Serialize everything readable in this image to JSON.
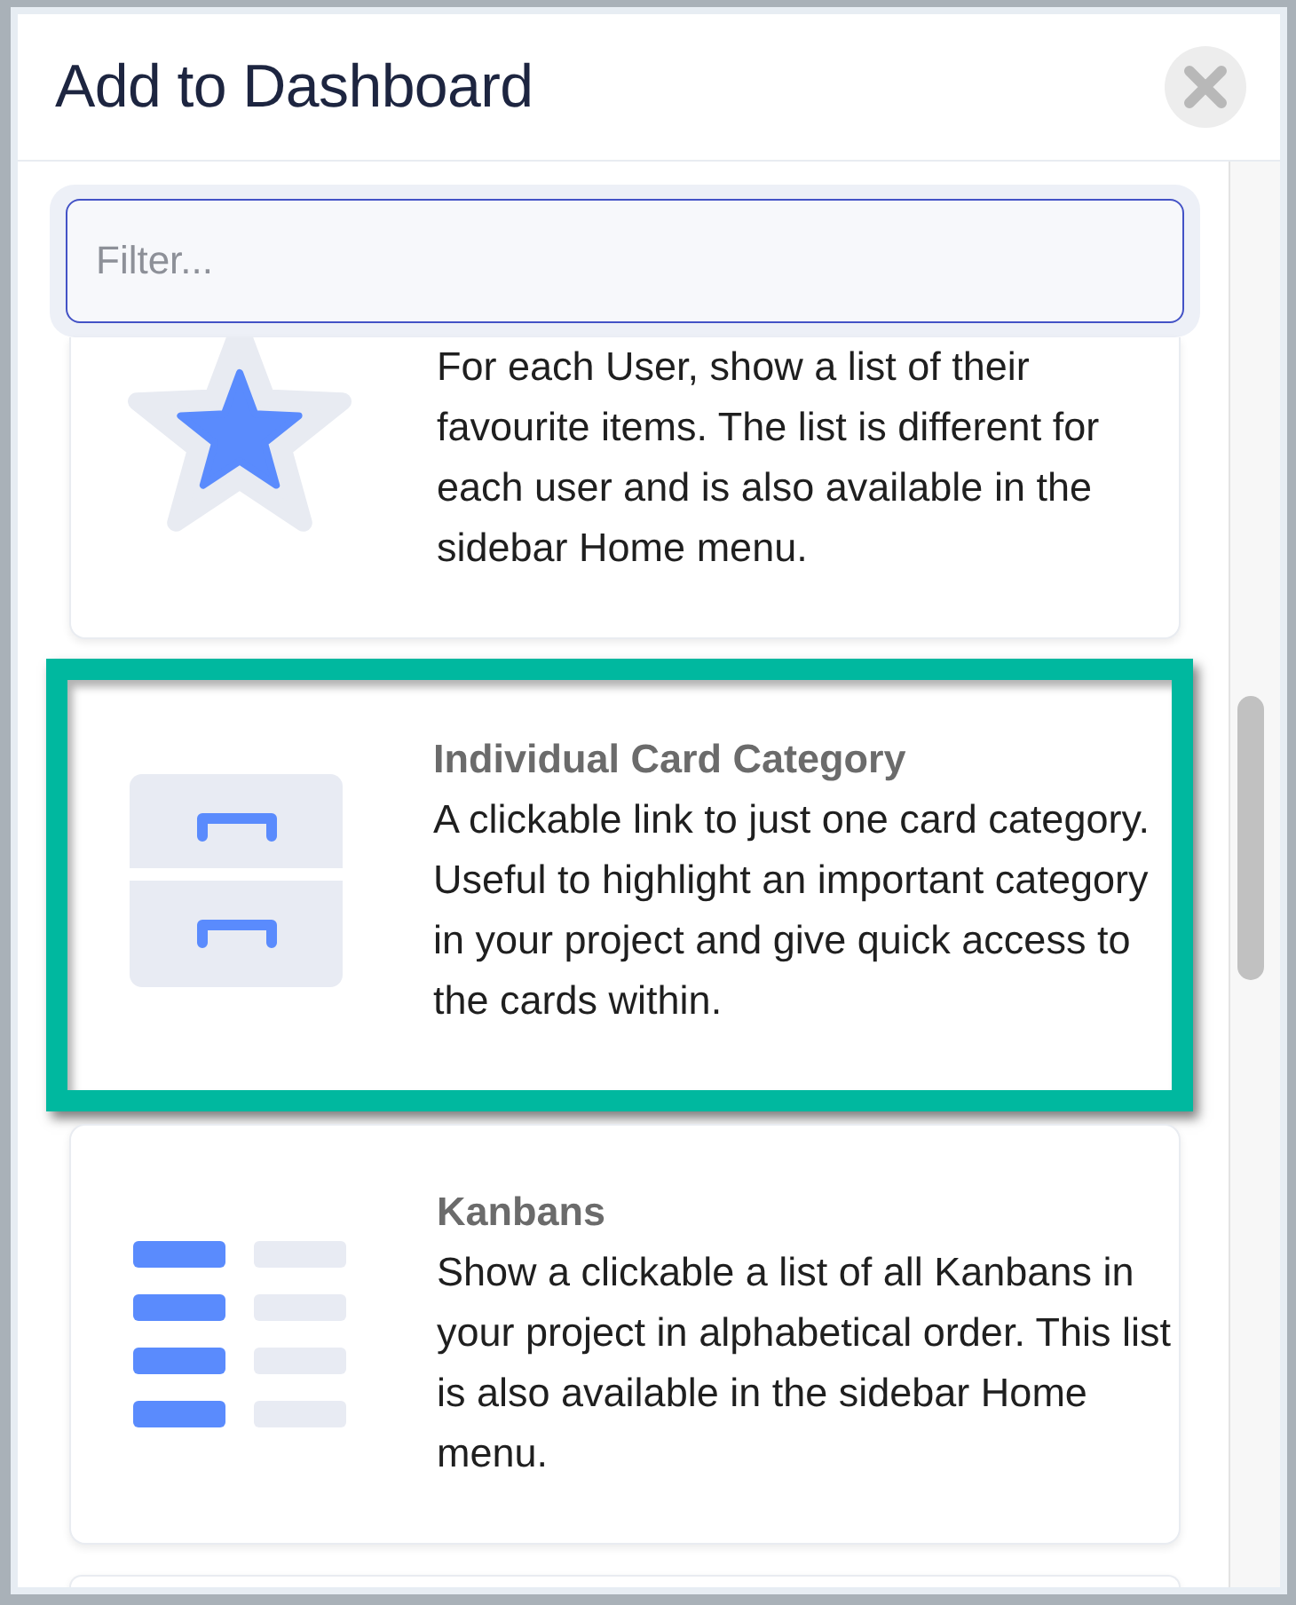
{
  "dialog": {
    "title": "Add to Dashboard"
  },
  "filter": {
    "placeholder": "Filter..."
  },
  "cards": [
    {
      "description": "For each User, show a list of their favourite items. The list is different for each user and is also available in the sidebar Home menu.",
      "selected": false
    },
    {
      "title": "Individual Card Category",
      "description": "A clickable link to just one card category. Useful to highlight an important category in your project and give quick access to the cards within.",
      "selected": true
    },
    {
      "title": "Kanbans",
      "description": "Show a clickable a list of all Kanbans in your project in alphabetical order. This list is also available in the sidebar Home menu.",
      "selected": false
    },
    {
      "selected": false
    }
  ]
}
